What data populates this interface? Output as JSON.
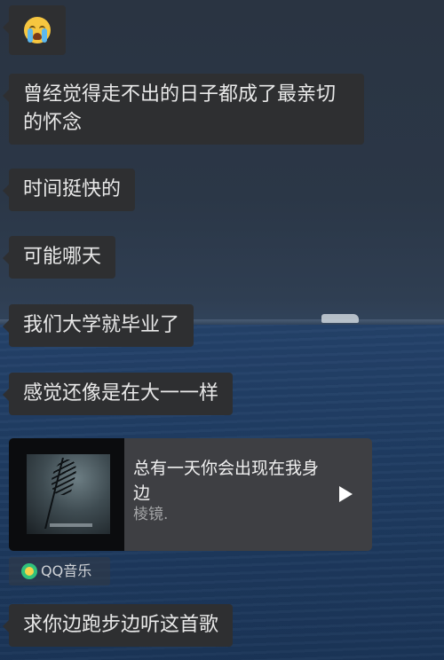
{
  "chat": {
    "emoji_message": {
      "emoji": "crying-face-icon"
    },
    "messages": [
      "曾经觉得走不出的日子都成了最亲切的怀念",
      "时间挺快的",
      "可能哪天",
      "我们大学就毕业了",
      "感觉还像是在大一一样",
      "求你边跑步边听这首歌"
    ],
    "music_card": {
      "title": "总有一天你会出现在我身边",
      "artist": "棱镜.",
      "play_icon": "play-icon",
      "source": "QQ音乐",
      "source_icon": "qq-music-icon"
    }
  },
  "colors": {
    "bubble_bg": "#2e2f31",
    "bubble_text": "#e9e9e9",
    "card_bg": "#3e3f43",
    "qq_green": "#31c27c"
  }
}
